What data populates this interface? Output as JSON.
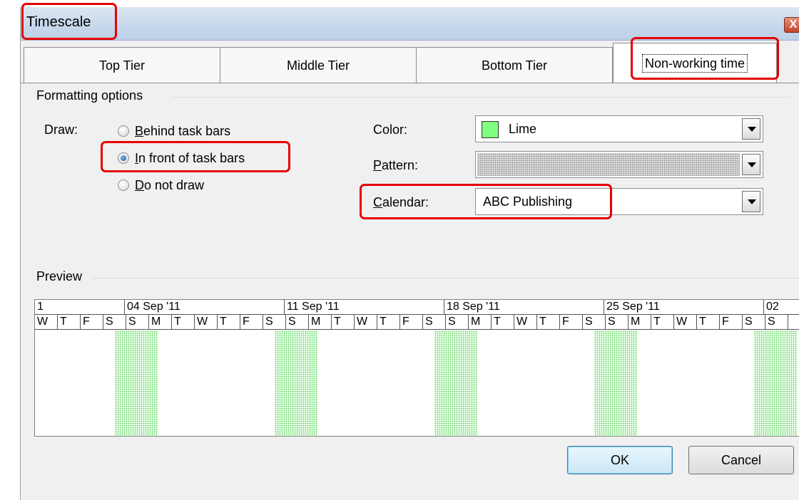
{
  "window": {
    "title": "Timescale",
    "close_label": "X"
  },
  "tabs": [
    {
      "label": "Top Tier",
      "active": false
    },
    {
      "label": "Middle Tier",
      "active": false
    },
    {
      "label": "Bottom Tier",
      "active": false
    },
    {
      "label": "Non-working time",
      "active": true
    }
  ],
  "formatting": {
    "group_label": "Formatting options",
    "draw_label": "Draw:",
    "draw_options": [
      {
        "label": "Behind task bars",
        "mnemonic": "B",
        "rest": "ehind task bars",
        "selected": false
      },
      {
        "label": "In front of task bars",
        "mnemonic": "I",
        "rest": "n front of task bars",
        "selected": true
      },
      {
        "label": "Do not draw",
        "mnemonic": "D",
        "rest": "o not draw",
        "selected": false
      }
    ],
    "color": {
      "label": "Color:",
      "value": "Lime",
      "swatch": "#80ff80"
    },
    "pattern": {
      "label_mnemonic": "P",
      "label_rest": "attern:",
      "label": "Pattern:"
    },
    "calendar": {
      "label_mnemonic": "C",
      "label_rest": "alendar:",
      "label": "Calendar:",
      "value": "ABC Publishing"
    }
  },
  "preview": {
    "group_label": "Preview",
    "weeks": [
      "1",
      "04 Sep '11",
      "11 Sep '11",
      "18 Sep '11",
      "25 Sep '11",
      "02"
    ],
    "days": [
      "W",
      "T",
      "F",
      "S",
      "S",
      "M",
      "T",
      "W",
      "T",
      "F",
      "S",
      "S",
      "M",
      "T",
      "W",
      "T",
      "F",
      "S",
      "S",
      "M",
      "T",
      "W",
      "T",
      "F",
      "S",
      "S",
      "M",
      "T",
      "W",
      "T",
      "F",
      "S",
      "S"
    ],
    "nonworking_color": "#66d966"
  },
  "buttons": {
    "ok": "OK",
    "cancel": "Cancel"
  },
  "highlight_color": "#e60000"
}
